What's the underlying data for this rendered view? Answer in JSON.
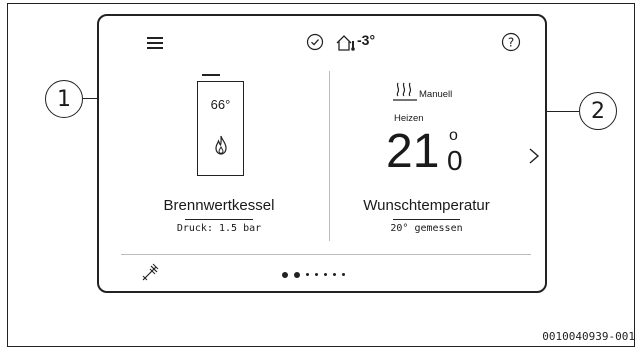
{
  "header": {
    "outdoor_temperature": "-3°"
  },
  "boiler": {
    "display_value": "66°",
    "title": "Brennwertkessel",
    "pressure": "Druck: 1.5 bar"
  },
  "heating": {
    "mode_label": "Manuell",
    "status_label": "Heizen",
    "setpoint_integer": "21",
    "setpoint_decimal": "0",
    "degree_symbol": "o",
    "title": "Wunschtemperatur",
    "measured": "20° gemessen"
  },
  "pagination": {
    "count": 7,
    "active_index": 1
  },
  "callouts": {
    "one": "1",
    "two": "2"
  },
  "figure_id": "0010040939-001",
  "colors": {
    "line": "#222222",
    "background": "#ffffff"
  },
  "icons": [
    "menu-icon",
    "check-circle-icon",
    "house-thermometer-icon",
    "help-icon",
    "heat-waves-icon",
    "flame-icon",
    "chevron-right-icon",
    "chimney-sweep-icon"
  ]
}
